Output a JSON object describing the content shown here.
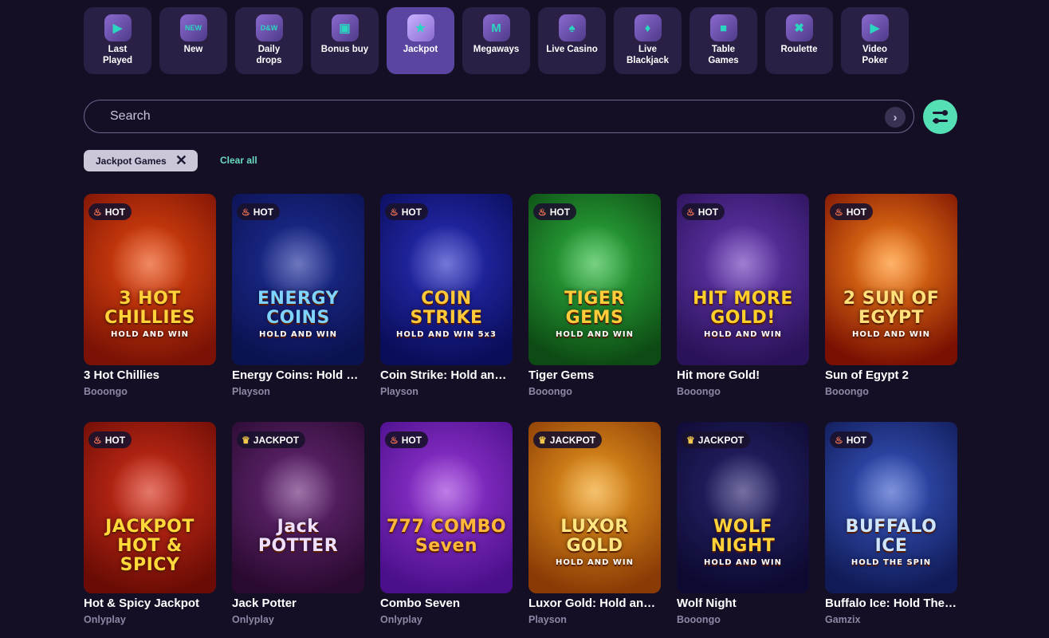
{
  "categories": [
    {
      "label": "Last\nPlayed",
      "icon": "play-icon",
      "glyph": "▶",
      "active": false
    },
    {
      "label": "New",
      "icon": "new-icon",
      "glyph": "NEW",
      "active": false
    },
    {
      "label": "Daily\ndrops",
      "icon": "daily-drops-icon",
      "glyph": "D&W",
      "active": false
    },
    {
      "label": "Bonus buy",
      "icon": "bonus-buy-icon",
      "glyph": "▣",
      "active": false
    },
    {
      "label": "Jackpot",
      "icon": "jackpot-icon",
      "glyph": "★",
      "active": true
    },
    {
      "label": "Megaways",
      "icon": "megaways-icon",
      "glyph": "M",
      "active": false
    },
    {
      "label": "Live Casino",
      "icon": "live-casino-icon",
      "glyph": "♠",
      "active": false
    },
    {
      "label": "Live\nBlackjack",
      "icon": "blackjack-icon",
      "glyph": "♦",
      "active": false
    },
    {
      "label": "Table\nGames",
      "icon": "table-games-icon",
      "glyph": "■",
      "active": false
    },
    {
      "label": "Roulette",
      "icon": "roulette-icon",
      "glyph": "✖",
      "active": false
    },
    {
      "label": "Video\nPoker",
      "icon": "video-poker-icon",
      "glyph": "▶",
      "active": false
    }
  ],
  "search": {
    "placeholder": "Search",
    "icon": "chevron-right-icon"
  },
  "filters": {
    "active_chip": "Jackpot Games",
    "clear_label": "Clear all",
    "filter_icon": "sliders-icon"
  },
  "games": [
    {
      "name": "3 Hot Chillies",
      "provider": "Booongo",
      "badge": "HOT",
      "badge_icon": "flame-icon",
      "art": "3 HOT CHILLIES",
      "art_sub": "HOLD AND WIN",
      "bg": [
        "#e84a10",
        "#7a1205"
      ],
      "art_color": "#ffd23a"
    },
    {
      "name": "Energy Coins: Hold and Win",
      "provider": "Playson",
      "badge": "HOT",
      "badge_icon": "flame-icon",
      "art": "ENERGY COINS",
      "art_sub": "HOLD AND WIN",
      "bg": [
        "#1f2f9a",
        "#0b1250"
      ],
      "art_color": "#7fd4ff"
    },
    {
      "name": "Coin Strike: Hold and Win",
      "provider": "Playson",
      "badge": "HOT",
      "badge_icon": "flame-icon",
      "art": "COIN STRIKE",
      "art_sub": "HOLD AND WIN 5x3",
      "bg": [
        "#2a2fc0",
        "#0a0d58"
      ],
      "art_color": "#ffc93a"
    },
    {
      "name": "Tiger Gems",
      "provider": "Booongo",
      "badge": "HOT",
      "badge_icon": "flame-icon",
      "art": "TIGER GEMS",
      "art_sub": "HOLD AND WIN",
      "bg": [
        "#2fb840",
        "#0d4a14"
      ],
      "art_color": "#ffcc3a"
    },
    {
      "name": "Hit more Gold!",
      "provider": "Booongo",
      "badge": "HOT",
      "badge_icon": "flame-icon",
      "art": "HIT MORE GOLD!",
      "art_sub": "HOLD AND WIN",
      "bg": [
        "#6a3ab8",
        "#2a1258"
      ],
      "art_color": "#ffcf2a"
    },
    {
      "name": "Sun of Egypt 2",
      "provider": "Booongo",
      "badge": "HOT",
      "badge_icon": "flame-icon",
      "art": "2 SUN OF EGYPT",
      "art_sub": "HOLD AND WIN",
      "bg": [
        "#ff8a1a",
        "#7a1002"
      ],
      "art_color": "#ffe07a"
    },
    {
      "name": "Hot & Spicy Jackpot",
      "provider": "Onlyplay",
      "badge": "HOT",
      "badge_icon": "flame-icon",
      "art": "JACKPOT HOT & SPICY",
      "art_sub": "",
      "bg": [
        "#d6301a",
        "#6a0c05"
      ],
      "art_color": "#ffd83a"
    },
    {
      "name": "Jack Potter",
      "provider": "Onlyplay",
      "badge": "JACKPOT",
      "badge_icon": "crown-icon",
      "art": "Jack POTTER",
      "art_sub": "",
      "bg": [
        "#6a2a7a",
        "#2a0a30"
      ],
      "art_color": "#f0e0ff"
    },
    {
      "name": "Combo Seven",
      "provider": "Onlyplay",
      "badge": "HOT",
      "badge_icon": "flame-icon",
      "art": "777 COMBO Seven",
      "art_sub": "",
      "bg": [
        "#9a38d8",
        "#4a0f8a"
      ],
      "art_color": "#ffb83a"
    },
    {
      "name": "Luxor Gold: Hold and Win",
      "provider": "Playson",
      "badge": "JACKPOT",
      "badge_icon": "crown-icon",
      "art": "LUXOR GOLD",
      "art_sub": "HOLD AND WIN",
      "bg": [
        "#f0a020",
        "#8a3a05"
      ],
      "art_color": "#ffe680"
    },
    {
      "name": "Wolf Night",
      "provider": "Booongo",
      "badge": "JACKPOT",
      "badge_icon": "crown-icon",
      "art": "WOLF NIGHT",
      "art_sub": "HOLD AND WIN",
      "bg": [
        "#2a2470",
        "#0c0a30"
      ],
      "art_color": "#ffd23a"
    },
    {
      "name": "Buffalo Ice: Hold The Spin",
      "provider": "Gamzix",
      "badge": "HOT",
      "badge_icon": "flame-icon",
      "art": "BUFFALO ICE",
      "art_sub": "HOLD THE SPIN",
      "bg": [
        "#3a5ac8",
        "#101a55"
      ],
      "art_color": "#cfe6ff"
    }
  ]
}
